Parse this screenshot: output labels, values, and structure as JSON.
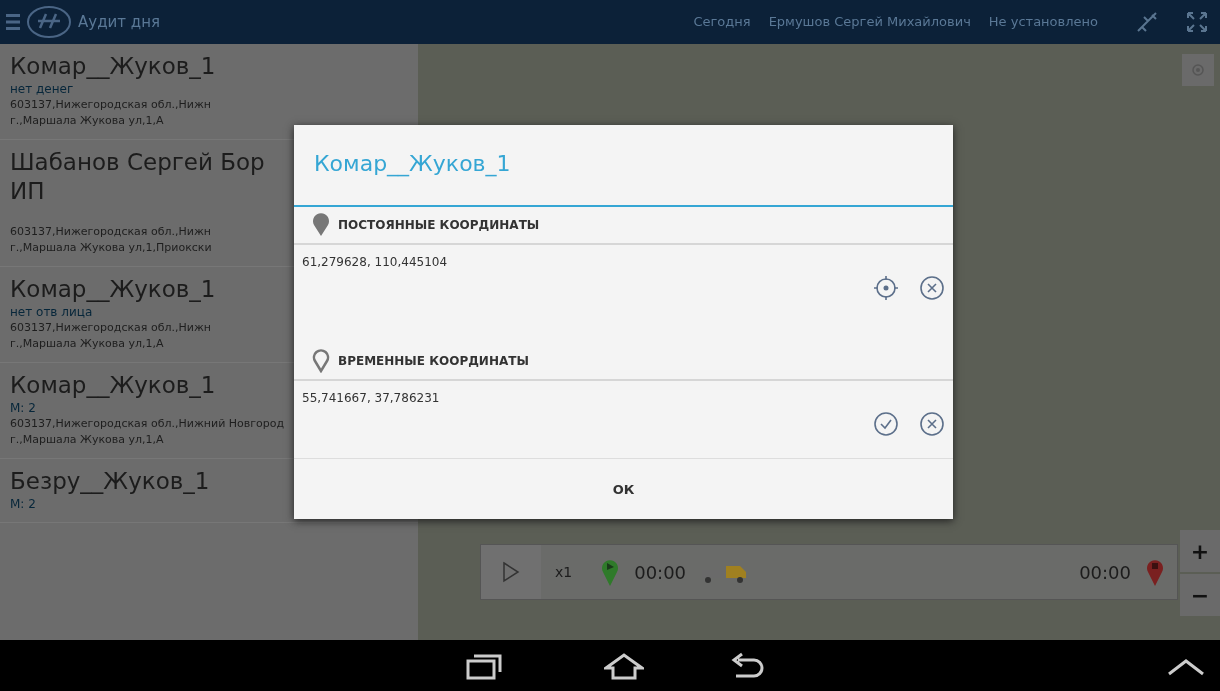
{
  "top_bar": {
    "title": "Аудит дня",
    "filters": [
      "Сегодня",
      "Ермушов Сергей Михайлович",
      "Не установлено"
    ]
  },
  "list": [
    {
      "name_lines": [
        "Комар__Жуков_1"
      ],
      "note": "нет денег",
      "address_lines": [
        "603137,Нижегородская обл.,Нижн",
        "г.,Маршала Жукова ул,1,А"
      ]
    },
    {
      "name_lines": [
        "Шабанов Сергей Бор",
        "ИП"
      ],
      "address_lines": [
        "603137,Нижегородская обл.,Нижн",
        "г.,Маршала Жукова ул,1,Приокски"
      ]
    },
    {
      "name_lines": [
        "Комар__Жуков_1"
      ],
      "note": "нет отв лица",
      "address_lines": [
        "603137,Нижегородская обл.,Нижн",
        "г.,Маршала Жукова ул,1,А"
      ]
    },
    {
      "name_lines": [
        "Комар__Жуков_1"
      ],
      "note": "М: 2",
      "address_lines": [
        "603137,Нижегородская обл.,Нижний Новгород",
        "г.,Маршала Жукова ул,1,А"
      ]
    },
    {
      "name_lines": [
        "Безру__Жуков_1"
      ],
      "note": "М: 2"
    }
  ],
  "dialog": {
    "title": "Комар__Жуков_1",
    "sections": [
      {
        "kind": "permanent",
        "heading": "ПОСТОЯННЫЕ КООРДИНАТЫ",
        "coords": "61,279628, 110,445104",
        "actions": [
          {
            "kind": "locate"
          },
          {
            "kind": "clear"
          }
        ]
      },
      {
        "kind": "temporary",
        "heading": "ВРЕМЕННЫЕ КООРДИНАТЫ",
        "coords": "55,741667, 37,786231",
        "actions": [
          {
            "kind": "accept"
          },
          {
            "kind": "clear"
          }
        ]
      }
    ],
    "button": "ОК"
  },
  "playback": {
    "speed": "x1",
    "start_time": "00:00",
    "end_time": "00:00"
  },
  "zoom": [
    "+",
    "−"
  ]
}
